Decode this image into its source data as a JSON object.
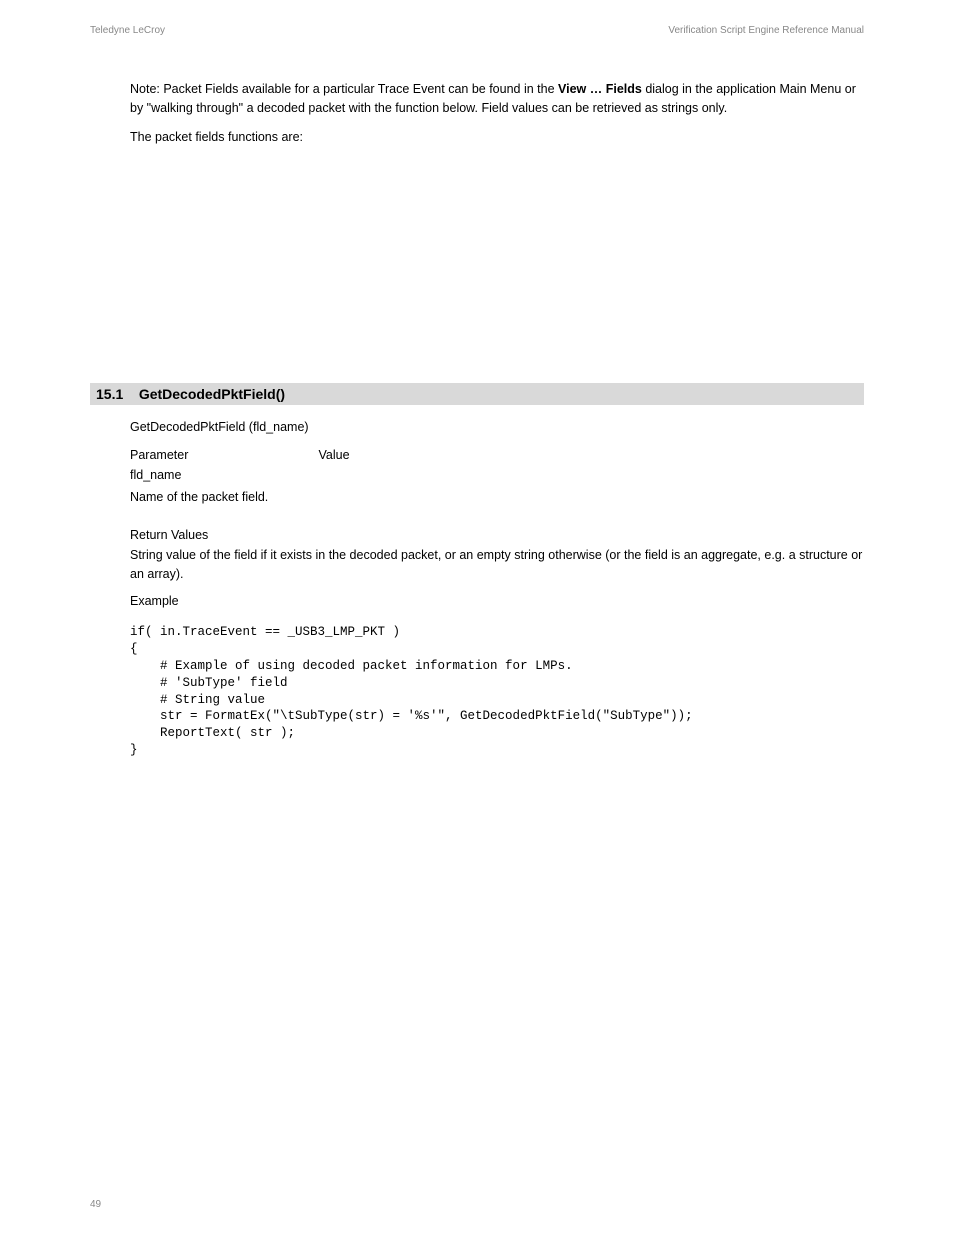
{
  "header": {
    "left": "Teledyne LeCroy",
    "right": "Verification Script Engine Reference Manual"
  },
  "intro": {
    "p1_a": "Note: Packet Fields available for a particular Trace Event can be found in the ",
    "p1_bold": "View … Fields",
    "p1_b": " dialog in the application Main Menu or by \"walking through\" a decoded packet with the function below. Field values can be retrieved as strings only.",
    "p2": "The packet fields functions are:"
  },
  "section": {
    "number": "15.1",
    "title": "GetDecodedPktField()"
  },
  "func": {
    "signature": "GetDecodedPktField (fld_name)"
  },
  "parameter": {
    "label": "Parameter",
    "value": "Value",
    "name": "fld_name",
    "desc": "Name of the packet field."
  },
  "return": {
    "label": "Return Values",
    "desc": "String value of the field if it exists in the decoded packet, or an empty string otherwise (or the field is an aggregate, e.g. a structure or an array)."
  },
  "example": {
    "label": "Example",
    "code": "if( in.TraceEvent == _USB3_LMP_PKT )\n{\n    # Example of using decoded packet information for LMPs.\n    # 'SubType' field\n    # String value\n    str = FormatEx(\"\\tSubType(str) = '%s'\", GetDecodedPktField(\"SubType\"));\n    ReportText( str );\n}"
  },
  "footer": {
    "left": "49",
    "right": ""
  }
}
